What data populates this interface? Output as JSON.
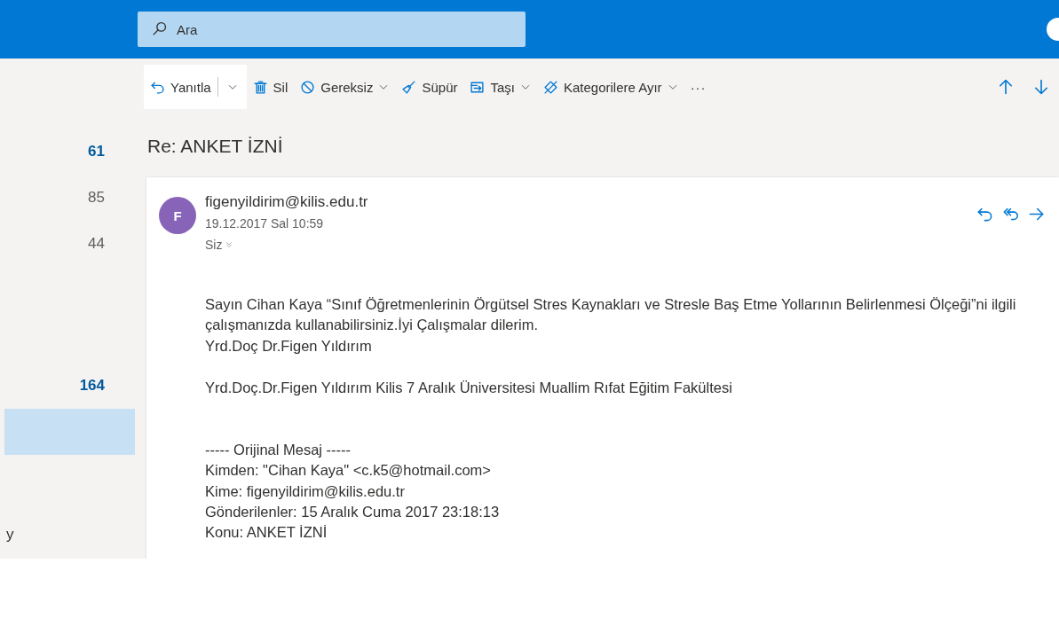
{
  "search": {
    "placeholder": "Ara"
  },
  "toolbar": [
    {
      "kind": "split",
      "label": "Yanıtla"
    },
    {
      "kind": "button",
      "label": "Sil"
    },
    {
      "kind": "menu",
      "label": "Gereksiz"
    },
    {
      "kind": "button",
      "label": "Süpür"
    },
    {
      "kind": "menu",
      "label": "Taşı"
    },
    {
      "kind": "menu",
      "label": "Kategorilere Ayır"
    },
    {
      "kind": "more",
      "label": "···"
    },
    {
      "kind": "nav"
    },
    {
      "kind": "nav"
    }
  ],
  "sidebar": {
    "items": [
      {
        "count": "61",
        "unread": true,
        "selected": false
      },
      {
        "count": "85",
        "unread": false,
        "selected": false
      },
      {
        "count": "44",
        "unread": false,
        "selected": false
      },
      {
        "count": "164",
        "unread": true,
        "selected": false
      },
      {
        "selected": true
      },
      {
        "label": "y",
        "selected": false
      }
    ]
  },
  "message": {
    "subject": "Re: ANKET İZNİ",
    "avatar": {
      "initial": "F",
      "color": "#8764b8"
    },
    "sender": "figenyildirim@kilis.edu.tr",
    "date": "19.12.2017 Sal 10:59",
    "to": "Siz",
    "body": [
      {
        "kind": "paragraph",
        "lines": [
          "Sayın Cihan Kaya “Sınıf Öğretmenlerinin Örgütsel Stres Kaynakları ve Stresle Baş Etme Yollarının Belirlenmesi Ölçeği”ni ilgili çalışmanızda kullanabilirsiniz.İyi Çalışmalar dilerim.",
          "Yrd.Doç Dr.Figen Yıldırım"
        ]
      },
      {
        "kind": "paragraph",
        "lines": [
          "Yrd.Doç.Dr.Figen Yıldırım Kilis 7 Aralık Üniversitesi Muallim Rıfat Eğitim Fakültesi"
        ]
      },
      {
        "kind": "quote",
        "lines": [
          "----- Orijinal Mesaj -----",
          "Kimden: \"Cihan Kaya\" <c.k5@hotmail.com>",
          "Kime: figenyildirim@kilis.edu.tr",
          "Gönderilenler: 15 Aralık Cuma 2017 23:18:13",
          "Konu: ANKET İZNİ"
        ]
      }
    ]
  }
}
